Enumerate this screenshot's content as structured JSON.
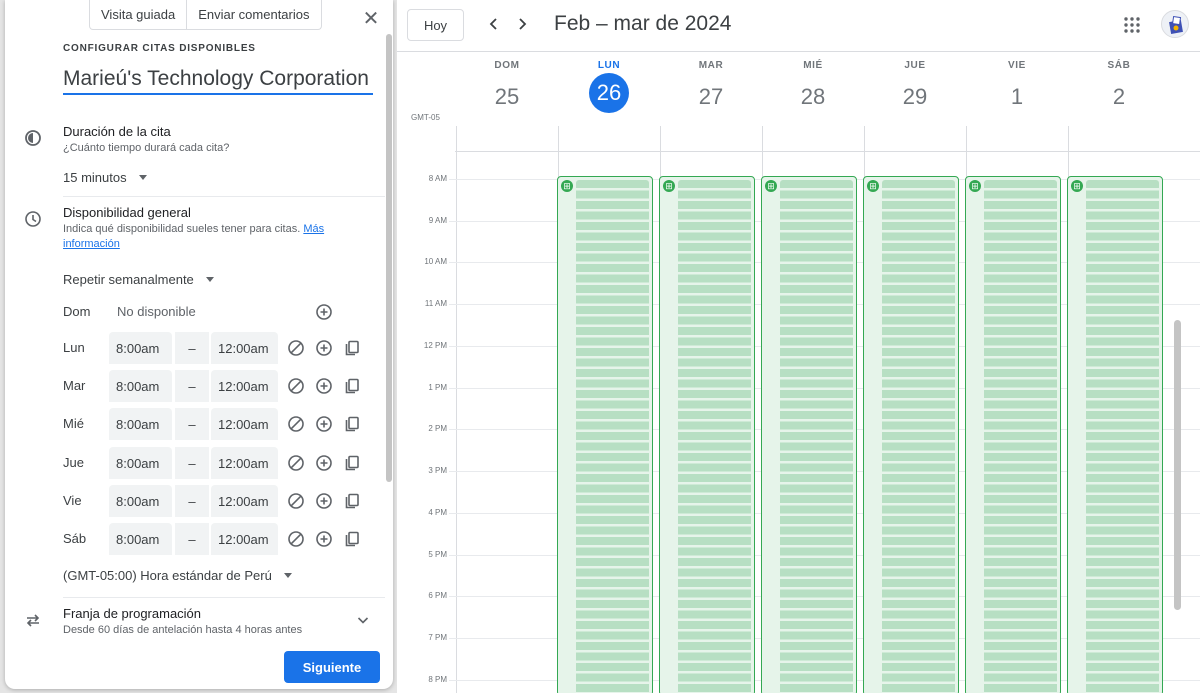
{
  "panel": {
    "tabs": [
      "Visita guiada",
      "Enviar comentarios"
    ],
    "caption": "CONFIGURAR CITAS DISPONIBLES",
    "title_value": "Marieú's Technology Corporation",
    "duration": {
      "title": "Duración de la cita",
      "subtitle": "¿Cuánto tiempo durará cada cita?",
      "value": "15 minutos"
    },
    "availability": {
      "title": "Disponibilidad general",
      "subtitle": "Indica qué disponibilidad sueles tener para citas.",
      "link_text": "Más información",
      "repeat": "Repetir semanalmente",
      "days": [
        {
          "label": "Dom",
          "available": false,
          "status": "No disponible"
        },
        {
          "label": "Lun",
          "available": true,
          "from": "8:00am",
          "sep": "–",
          "to": "12:00am"
        },
        {
          "label": "Mar",
          "available": true,
          "from": "8:00am",
          "sep": "–",
          "to": "12:00am"
        },
        {
          "label": "Mié",
          "available": true,
          "from": "8:00am",
          "sep": "–",
          "to": "12:00am"
        },
        {
          "label": "Jue",
          "available": true,
          "from": "8:00am",
          "sep": "–",
          "to": "12:00am"
        },
        {
          "label": "Vie",
          "available": true,
          "from": "8:00am",
          "sep": "–",
          "to": "12:00am"
        },
        {
          "label": "Sáb",
          "available": true,
          "from": "8:00am",
          "sep": "–",
          "to": "12:00am"
        }
      ],
      "timezone": "(GMT-05:00) Hora estándar de Perú"
    },
    "scheduling": {
      "title": "Franja de programación",
      "subtitle": "Desde 60 días de antelación hasta 4 horas antes"
    },
    "next_button": "Siguiente"
  },
  "calendar": {
    "today_button": "Hoy",
    "range_title": "Feb – mar de 2024",
    "timezone_label": "GMT-05",
    "days": [
      {
        "dow": "DOM",
        "num": "25",
        "today": false
      },
      {
        "dow": "LUN",
        "num": "26",
        "today": true
      },
      {
        "dow": "MAR",
        "num": "27",
        "today": false
      },
      {
        "dow": "MIÉ",
        "num": "28",
        "today": false
      },
      {
        "dow": "JUE",
        "num": "29",
        "today": false
      },
      {
        "dow": "VIE",
        "num": "1",
        "today": false
      },
      {
        "dow": "SÁB",
        "num": "2",
        "today": false
      }
    ],
    "hours": [
      "8 AM",
      "9 AM",
      "10 AM",
      "11 AM",
      "12 PM",
      "1 PM",
      "2 PM",
      "3 PM",
      "4 PM",
      "5 PM",
      "6 PM",
      "7 PM",
      "8 PM"
    ],
    "accent": "#1a73e8",
    "slot_color": "#34a853"
  }
}
